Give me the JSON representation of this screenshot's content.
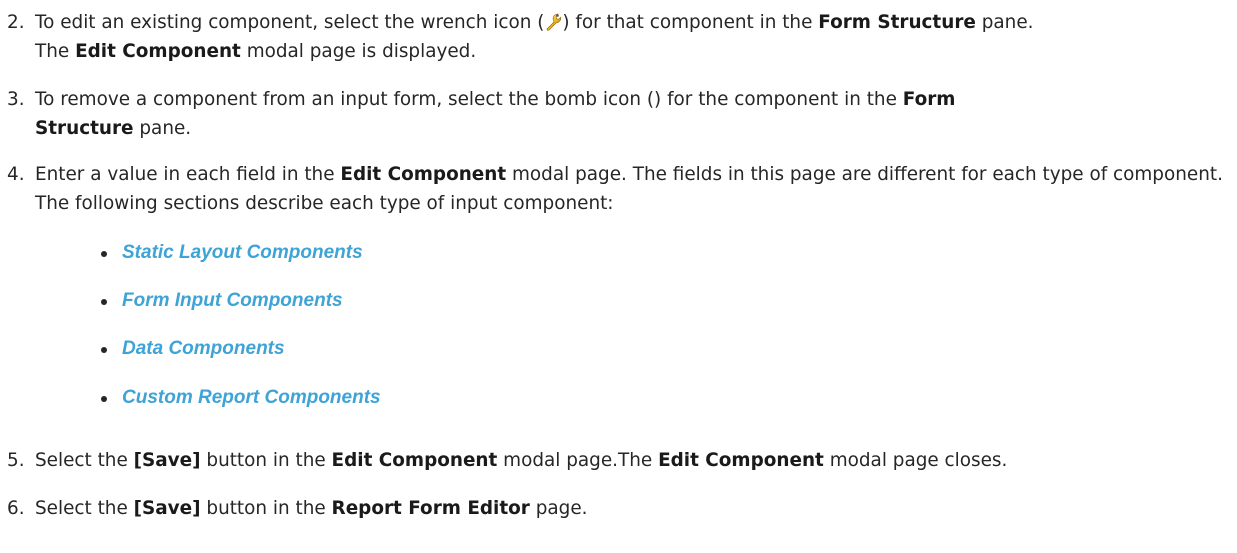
{
  "steps": [
    {
      "number": "2.",
      "part1": "To edit an existing component, select the wrench icon (",
      "part2": ") for that component in the ",
      "bold1": "Form Structure",
      "part3": " pane.",
      "bold2": "Edit Component",
      "part4": "The ",
      "part5": " modal page is displayed."
    },
    {
      "number": "3.",
      "part1": "To remove a component from an input form, select the bomb icon () for the component in the ",
      "bold1": "Form",
      "bold2": "Structure",
      "part2": " pane."
    },
    {
      "number": "4.",
      "part1": "Enter a value in each field in the ",
      "bold1": "Edit Component",
      "part2": " modal page. The fields in this page are different for each type of component. The following sections describe each type of input component:"
    },
    {
      "number": "5.",
      "part1": "Select the ",
      "bold1": "[Save]",
      "part2": " button in the ",
      "bold2": "Edit Component",
      "part3": " modal page.The ",
      "bold3": "Edit Component",
      "part4": " modal page closes."
    },
    {
      "number": "6.",
      "part1": "Select the ",
      "bold1": "[Save]",
      "part2": " button in the ",
      "bold2": "Report Form Editor",
      "part3": " page."
    }
  ],
  "links": [
    "Static Layout Components",
    "Form Input Components",
    "Data Components",
    "Custom Report Components"
  ],
  "colors": {
    "link": "#3ea3d6",
    "text": "#262626"
  },
  "icons": [
    "wrench-icon"
  ]
}
